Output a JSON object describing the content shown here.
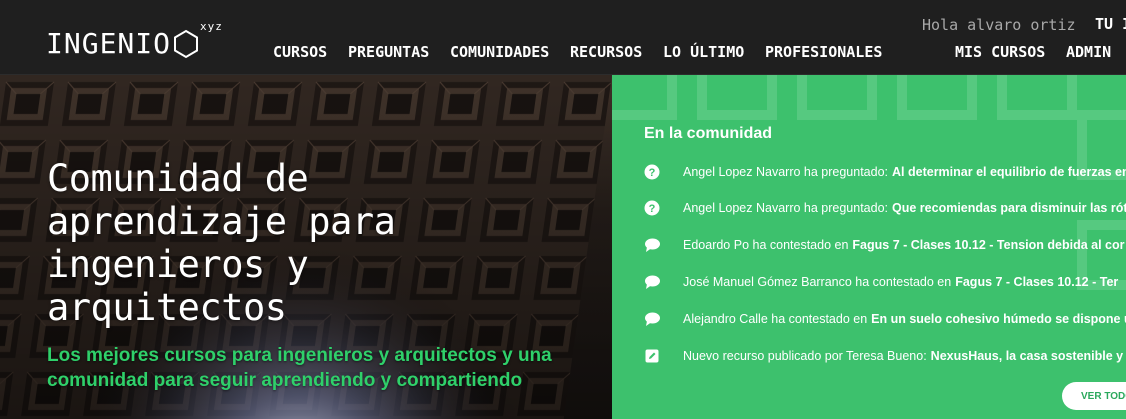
{
  "header": {
    "logo_text": "INGENIO",
    "logo_suffix": "xyz",
    "greeting": "Hola alvaro ortiz",
    "user_short": "TU I",
    "nav": [
      {
        "label": "CURSOS"
      },
      {
        "label": "PREGUNTAS"
      },
      {
        "label": "COMUNIDADES"
      },
      {
        "label": "RECURSOS"
      },
      {
        "label": "LO ÚLTIMO"
      },
      {
        "label": "PROFESIONALES"
      },
      {
        "label": "MIS CURSOS"
      },
      {
        "label": "ADMIN"
      }
    ]
  },
  "hero": {
    "title": "Comunidad de aprendizaje para ingenieros y arquitectos",
    "subtitle": "Los mejores cursos para ingenieros y arquitectos y una comunidad para seguir aprendiendo y compartiendo"
  },
  "community": {
    "title": "En la comunidad",
    "items": [
      {
        "icon": "question-icon",
        "who": "Angel Lopez Navarro ha preguntado:",
        "target": "Al determinar el equilibrio de fuerzas en"
      },
      {
        "icon": "question-icon",
        "who": "Angel Lopez Navarro ha preguntado:",
        "target": "Que recomiendas para disminuir las rótu"
      },
      {
        "icon": "comment-icon",
        "who": "Edoardo Po ha contestado en",
        "target": "Fagus 7 - Clases 10.12 - Tension debida al cor"
      },
      {
        "icon": "comment-icon",
        "who": "José Manuel Gómez Barranco ha contestado en",
        "target": "Fagus 7 - Clases 10.12 - Ter"
      },
      {
        "icon": "comment-icon",
        "who": "Alejandro Calle ha contestado en",
        "target": "En un suelo cohesivo húmedo se dispone u"
      },
      {
        "icon": "edit-icon",
        "who": "Nuevo recurso publicado por Teresa Bueno:",
        "target": "NexusHaus, la casa sostenible y"
      }
    ],
    "view_all_label": "VER TODO"
  },
  "colors": {
    "header_bg": "#1f1f1f",
    "accent_green": "#3dc16d",
    "subtitle_green": "#2fd06a"
  }
}
